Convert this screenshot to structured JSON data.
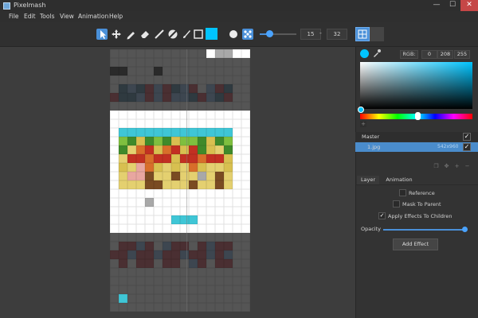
{
  "window": {
    "title": "Pixelmash",
    "minimize": "—",
    "maximize": "☐",
    "close": "✕"
  },
  "menu": [
    "File",
    "Edit",
    "Tools",
    "View",
    "Animation",
    "Help"
  ],
  "toolbar": {
    "tools": [
      "select-arrow-icon",
      "move-icon",
      "pencil-icon",
      "eraser-icon",
      "line-icon",
      "fill-icon",
      "brush-icon",
      "rect-icon"
    ],
    "active_tool": "select-arrow-icon",
    "primary_color": "#00c4ff",
    "brush_size": "15",
    "brush_size_max": "32",
    "dash": "-",
    "grid_view_active": true
  },
  "color_picker": {
    "mode_label": "RGB:",
    "r": "0",
    "g": "208",
    "b": "255",
    "current_color": "#00c4ff",
    "add_swatch": "+"
  },
  "layers": {
    "master": {
      "label": "Master",
      "checked": "✓"
    },
    "items": [
      {
        "label": "1.jpg",
        "size": "542x960",
        "checked": "✓"
      }
    ]
  },
  "layer_actions": [
    "copy-icon",
    "move-icon",
    "add-icon",
    "remove-icon"
  ],
  "tabs": {
    "layer": "Layer",
    "animation": "Animation",
    "active": "layer"
  },
  "properties": {
    "reference": {
      "label": "Reference",
      "checked": false
    },
    "mask_to_parent": {
      "label": "Mask To Parent",
      "checked": false
    },
    "apply_effects": {
      "label": "Apply Effects To Children",
      "checked": true
    },
    "opacity_label": "Opacity",
    "opacity_value": 1.0,
    "add_effect": "Add Effect"
  }
}
